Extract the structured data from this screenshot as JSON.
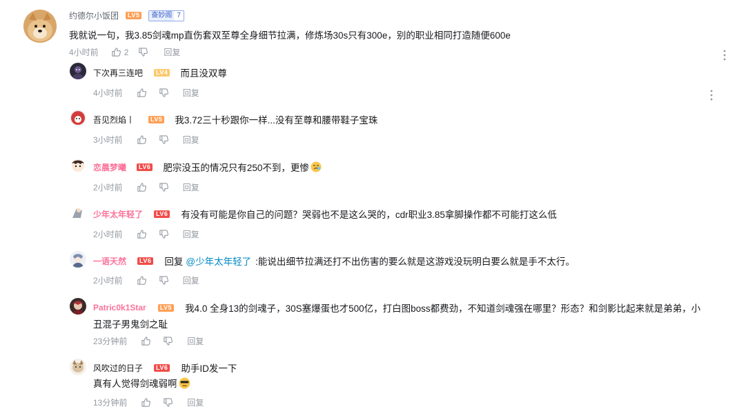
{
  "main_comment": {
    "username": "约德尔小饭团",
    "level": "LV5",
    "fan_badge_name": "奋妙阁",
    "fan_badge_level": "7",
    "text": "我就说一句，我3.85剑魂mp直伤套双至尊全身细节拉满，修炼场30s只有300e，别的职业相同打造随便600e",
    "time": "4小时前",
    "like_count": "2",
    "reply_label": "回复"
  },
  "replies": [
    {
      "username": "下次再三连吧",
      "level": "LV4",
      "text": "而且没双尊",
      "time": "4小时前",
      "reply_label": "回复"
    },
    {
      "username": "吾见烈焰丨",
      "level": "LV5",
      "text": "我3.72三十秒跟你一样...没有至尊和腰带鞋子宝珠",
      "time": "3小时前",
      "reply_label": "回复"
    },
    {
      "username": "恋晨梦曦",
      "level": "LV6",
      "text": "肥宗没玉的情况只有250不到，更惨",
      "time": "2小时前",
      "reply_label": "回复"
    },
    {
      "username": "少年太年轻了",
      "level": "LV6",
      "text": "有没有可能是你自己的问题？哭弱也不是这么哭的，cdr职业3.85拿脚操作都不可能打这么低",
      "time": "2小时前",
      "reply_label": "回复"
    },
    {
      "username": "一语天然",
      "level": "LV6",
      "text_prefix": "回复",
      "mention": "@少年太年轻了",
      "text": ":能说出细节拉满还打不出伤害的要么就是这游戏没玩明白要么就是手不太行。",
      "time": "2小时前",
      "reply_label": "回复"
    },
    {
      "username": "Patric0k1Star",
      "level": "LV5",
      "text_line1": "我4.0 全身13的剑魂子，30S塞爆蛋也才500亿，打白图boss都费劲，不知道剑魂强在哪里？形态？和剑影比起来就是弟弟，小",
      "text_line2": "丑混子男鬼剑之耻",
      "time": "23分钟前",
      "reply_label": "回复"
    },
    {
      "username": "风吹过的日子",
      "level": "LV6",
      "text_line1": "助手ID发一下",
      "text_line2": "真有人觉得剑魂弱啊",
      "time": "13分钟前",
      "reply_label": "回复"
    }
  ],
  "colors": {
    "accent_pink": "#fb7299",
    "mention_blue": "#008ac5",
    "meta_gray": "#9499a0"
  }
}
